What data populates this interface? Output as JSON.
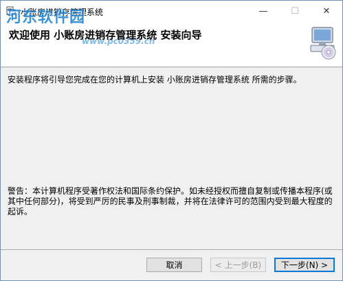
{
  "window": {
    "title": "小账房进销存管理系统",
    "minimize_glyph": "—",
    "maximize_glyph": "☐",
    "close_glyph": "✕"
  },
  "watermark": {
    "text": "河东软件园",
    "url": "www.pc0359.cn"
  },
  "header": {
    "title": "欢迎使用 小账房进销存管理系统 安装向导",
    "icon": "computer-cd-icon"
  },
  "body": {
    "intro": "安装程序将引导您完成在您的计算机上安装 小账房进销存管理系统 所需的步骤。",
    "warning": "警告：本计算机程序受著作权法和国际条约保护。如未经授权而擅自复制或传播本程序(或其中任何部分)，将受到严厉的民事及刑事制裁，并将在法律许可的范围内受到最大程度的起诉。"
  },
  "buttons": {
    "cancel": "取消",
    "back": "< 上一步(B)",
    "next": "下一步(N) >"
  },
  "colors": {
    "accent": "#0078d7",
    "watermark": "#1a7fd0",
    "dialog_bg": "#f0f0f0"
  }
}
